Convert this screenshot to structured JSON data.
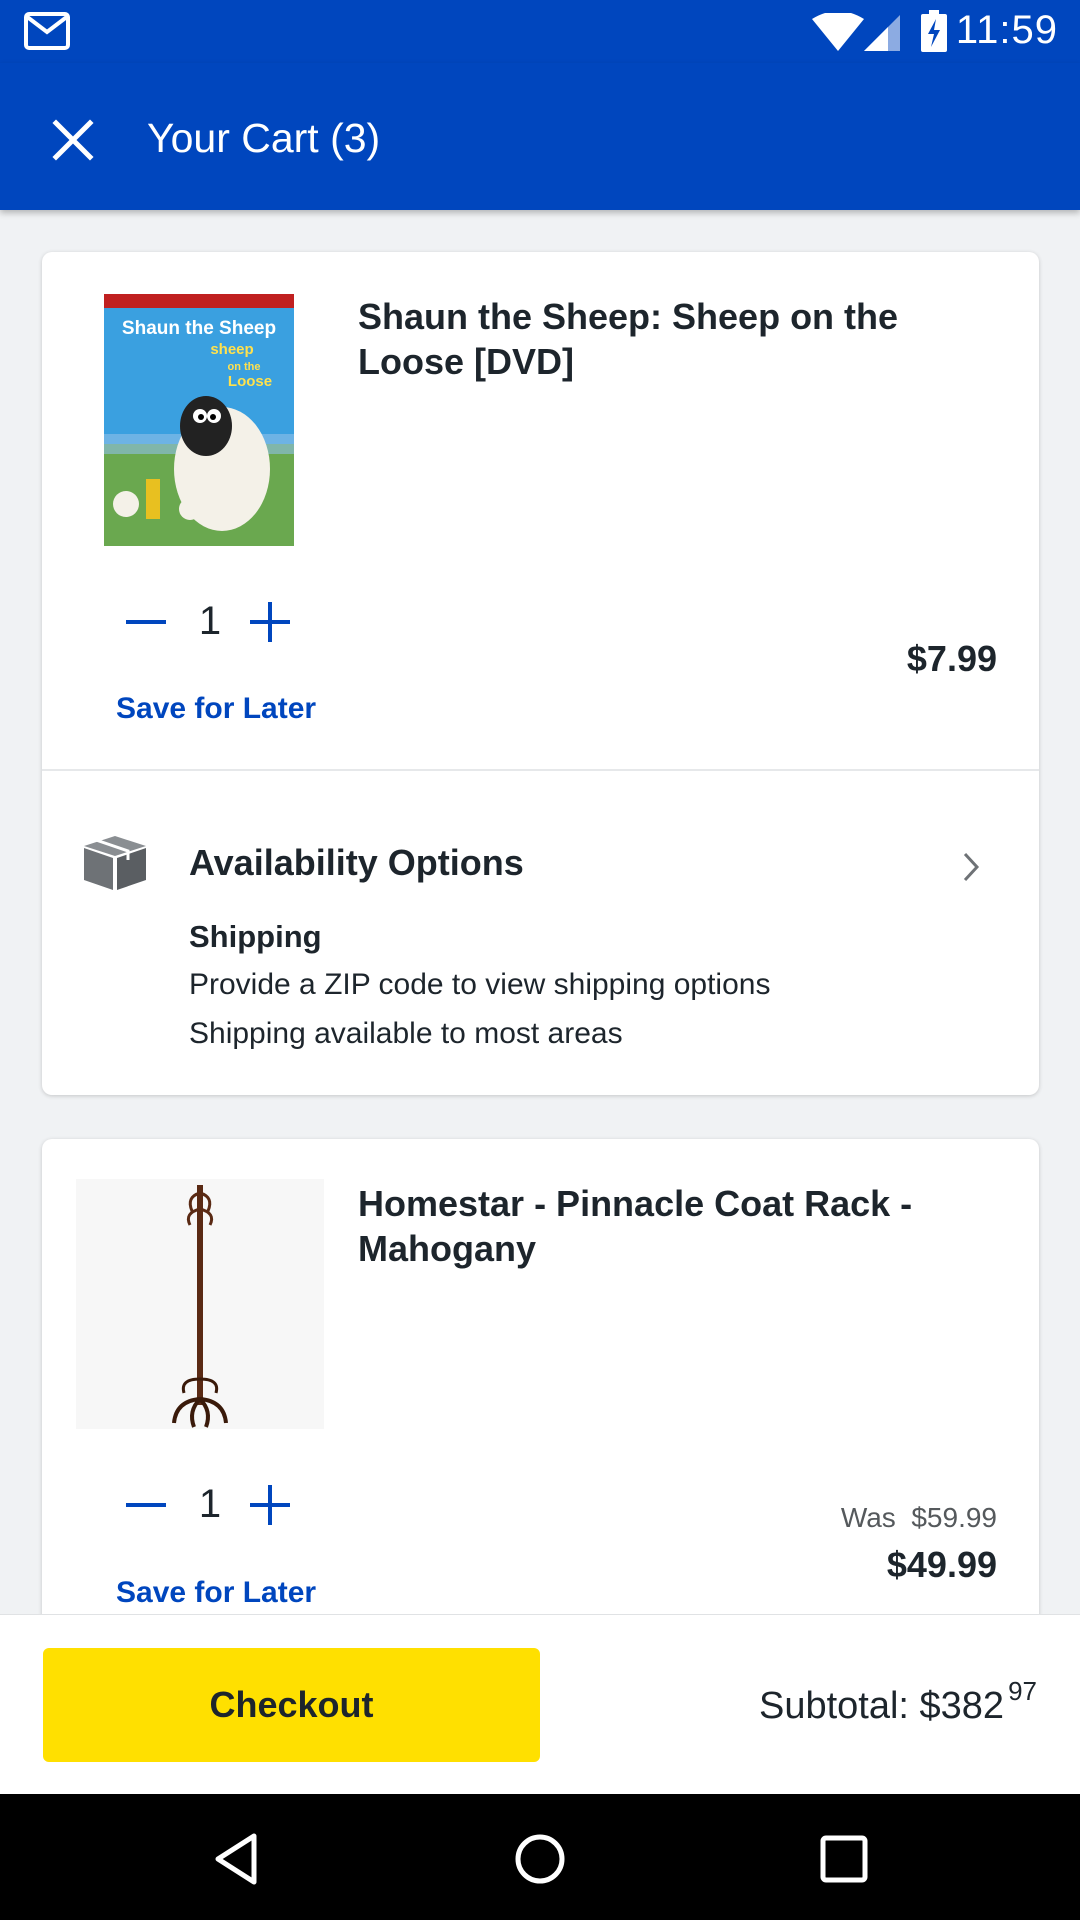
{
  "status_bar": {
    "time": "11:59"
  },
  "header": {
    "title": "Your Cart (3)"
  },
  "items": [
    {
      "title": "Shaun the Sheep: Sheep on the Loose [DVD]",
      "quantity": "1",
      "price": "$7.99",
      "save_for_later": "Save for Later",
      "thumbnail": {
        "cover_line1": "Shaun the Sheep",
        "cover_line2": "sheep",
        "cover_line3": "on the",
        "cover_line4": "Loose"
      }
    },
    {
      "title": "Homestar - Pinnacle Coat Rack - Mahogany",
      "quantity": "1",
      "was_label": "Was",
      "was_price": "$59.99",
      "price": "$49.99",
      "save_for_later": "Save for Later"
    }
  ],
  "availability": {
    "title": "Availability Options",
    "shipping_label": "Shipping",
    "line1": "Provide a ZIP code to view shipping options",
    "line2": "Shipping available to most areas"
  },
  "footer": {
    "checkout_label": "Checkout",
    "subtotal_label": "Subtotal:",
    "subtotal_dollars": "$382",
    "subtotal_cents": "97"
  },
  "colors": {
    "brand_blue": "#0046be",
    "checkout_yellow": "#ffe000"
  },
  "icons": [
    "gmail-icon",
    "wifi-icon",
    "signal-icon",
    "battery-icon",
    "close-icon",
    "minus-icon",
    "plus-icon",
    "box-icon",
    "chevron-right-icon",
    "nav-back-icon",
    "nav-home-icon",
    "nav-recents-icon"
  ]
}
